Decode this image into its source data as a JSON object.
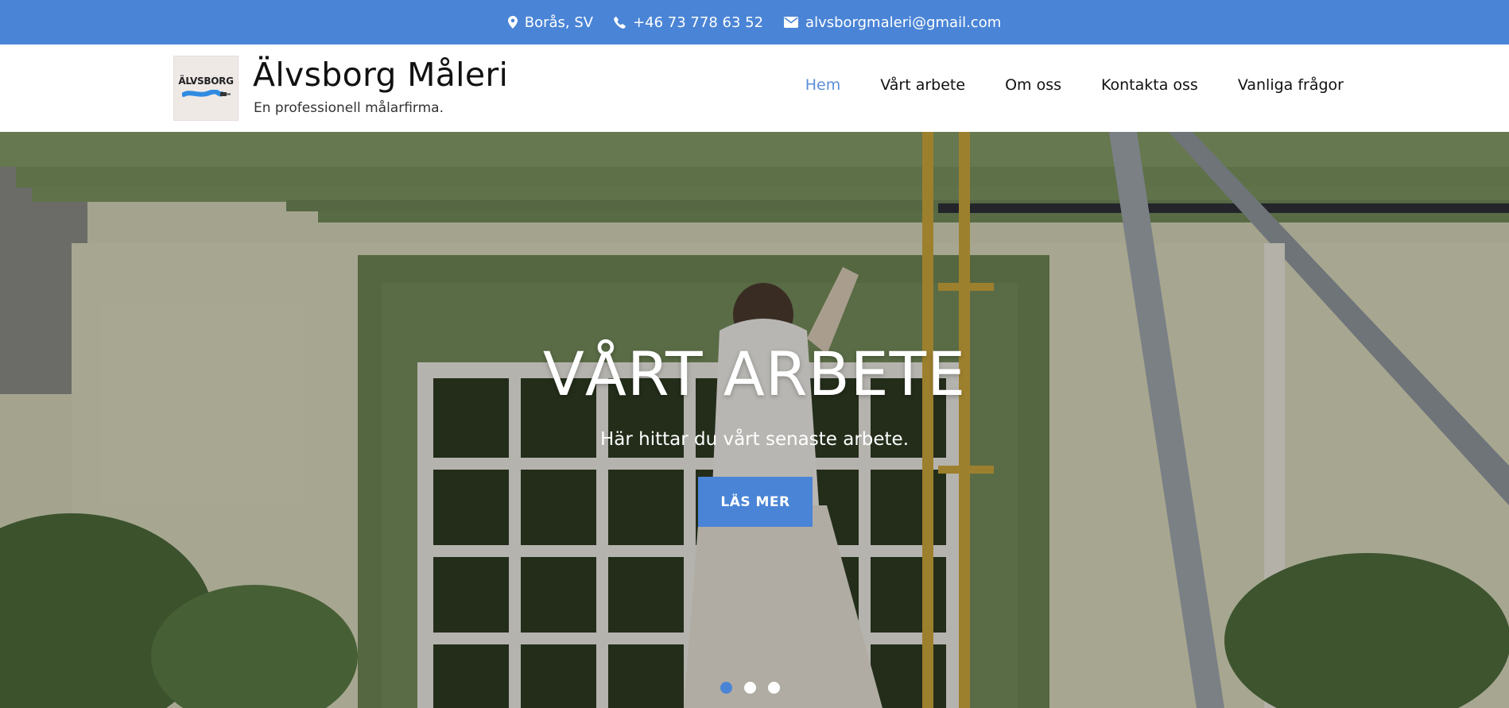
{
  "topbar": {
    "location": "Borås, SV",
    "phone": "+46 73 778 63 52",
    "email": "alvsborgmaleri@gmail.com",
    "location_icon": "map-pin-icon",
    "phone_icon": "phone-icon",
    "email_icon": "envelope-icon"
  },
  "header": {
    "logo_text": "ÄLVSBORG",
    "site_title": "Älvsborg Måleri",
    "tagline": "En professionell målarfirma."
  },
  "nav": {
    "items": [
      {
        "label": "Hem",
        "active": true
      },
      {
        "label": "Vårt arbete",
        "active": false
      },
      {
        "label": "Om oss",
        "active": false
      },
      {
        "label": "Kontakta oss",
        "active": false
      },
      {
        "label": "Vanliga frågor",
        "active": false
      }
    ]
  },
  "hero": {
    "title": "VÅRT ARBETE",
    "subtitle": "Här hittar du vårt senaste arbete.",
    "button_label": "LÄS MER",
    "slides_count": 3,
    "active_slide": 1
  },
  "colors": {
    "accent": "#4a84d6",
    "nav_active": "#5b8fd8"
  }
}
